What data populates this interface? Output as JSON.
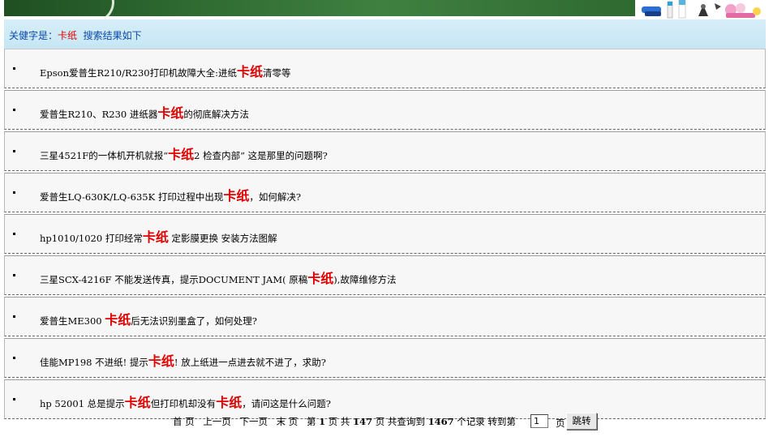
{
  "keyword_bar": {
    "prefix": "关健字是：",
    "keyword": "卡纸",
    "suffix": "搜索结果如下"
  },
  "results": [
    [
      {
        "t": "Epson爱普生R210/R230打印机故障大全:进纸"
      },
      {
        "t": "卡纸",
        "hl": true
      },
      {
        "t": "清零等"
      }
    ],
    [
      {
        "t": "爱普生R210、R230 进纸器"
      },
      {
        "t": "卡纸",
        "hl": true
      },
      {
        "t": "的彻底解决方法"
      }
    ],
    [
      {
        "t": "三星4521F的一体机开机就报“"
      },
      {
        "t": "卡纸",
        "hl": true
      },
      {
        "t": "2 检查内部” 这是那里的问题啊?"
      }
    ],
    [
      {
        "t": "爱普生LQ-630K/LQ-635K 打印过程中出现"
      },
      {
        "t": "卡纸",
        "hl": true
      },
      {
        "t": "，如何解决?"
      }
    ],
    [
      {
        "t": "hp1010/1020 打印经常"
      },
      {
        "t": "卡纸",
        "hl": true
      },
      {
        "t": " 定影膜更换  安装方法图解"
      }
    ],
    [
      {
        "t": "三星SCX-4216F 不能发送传真，提示DOCUMENT JAM( 原稿"
      },
      {
        "t": "卡纸",
        "hl": true
      },
      {
        "t": "),故障维修方法"
      }
    ],
    [
      {
        "t": "爱普生ME300 "
      },
      {
        "t": "卡纸",
        "hl": true
      },
      {
        "t": "后无法识别墨盒了，如何处理?"
      }
    ],
    [
      {
        "t": "佳能MP198 不进纸! 提示"
      },
      {
        "t": "卡纸",
        "hl": true
      },
      {
        "t": "! 放上纸进一点进去就不进了，求助?"
      }
    ],
    [
      {
        "t": "hp 52001 总是提示"
      },
      {
        "t": "卡纸",
        "hl": true
      },
      {
        "t": "但打印机却没有"
      },
      {
        "t": "卡纸",
        "hl": true
      },
      {
        "t": "，请问这是什么问题?"
      }
    ]
  ],
  "pager": {
    "first": "首 页",
    "prev": "上一页",
    "next": "下一页",
    "last": "末 页",
    "page_prefix": "第",
    "current_page": "1",
    "page_suffix": "页 共",
    "total_pages": "147",
    "total_suffix": "页 共查询到",
    "total_records": "1467",
    "records_suffix": "个记录 转到第",
    "input_value": "1",
    "unit": "页",
    "jump_label": "跳转"
  },
  "colors": {
    "keyword_red": "#e00000",
    "keyword_blue": "#0b4aa8",
    "banner_green": "#2f6b32"
  }
}
